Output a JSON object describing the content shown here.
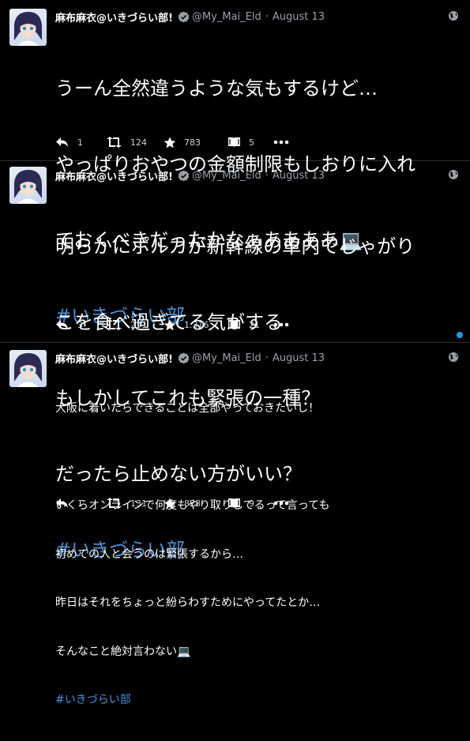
{
  "tweets": [
    {
      "name": "麻布麻衣@いきづらい部!",
      "handle": "@My_Mai_Eld",
      "dot": "·",
      "date": "August 13",
      "lines": [
        "うーん全然違うような気もするけど…",
        "やっぱりおやつの金額制限もしおりに入れ",
        "ておくべきだったかなぁああああ💻"
      ],
      "hashtag": "#いきづらい部",
      "replies": "1",
      "retweets": "124",
      "likes": "783",
      "quotes": "5"
    },
    {
      "name": "麻布麻衣@いきづらい部!",
      "handle": "@My_Mai_Eld",
      "dot": "·",
      "date": "August 13",
      "lines": [
        "明らかにポルカが新幹線の車内でじゃがり",
        "こを食べ過ぎてる気がする",
        "もしかしてこれも緊張の一種？",
        "だったら止めない方がいい？"
      ],
      "hashtag": "#いきづらい部",
      "replies": "3",
      "retweets": "231",
      "likes": "1.316",
      "quotes": "21"
    },
    {
      "name": "麻布麻衣@いきづらい部!",
      "handle": "@My_Mai_Eld",
      "dot": "·",
      "date": "August 13",
      "lines": [
        "大阪に着いたらできることは全部やっておきたいし！",
        "",
        "いくらオンラインで何度もやり取りしてるって言っても",
        "初めての人と会うのは緊張するから…",
        "昨日はそれをちょっと紛らわすためにやってたとか…",
        "そんなこと絶対言わない💻"
      ],
      "hashtag": "#いきづらい部",
      "replies": "1",
      "retweets": "131",
      "likes": "828",
      "quotes": "9"
    }
  ],
  "icons": [
    "avatar",
    "verified-badge-icon",
    "globe-icon",
    "reply-icon",
    "retweet-icon",
    "like-star-icon",
    "quote-book-icon",
    "more-icon"
  ],
  "colors": {
    "background": "#000000",
    "hashtag": "#4a90d9",
    "verified": "#9aa0a6",
    "unread_dot": "#1d9bf0"
  }
}
